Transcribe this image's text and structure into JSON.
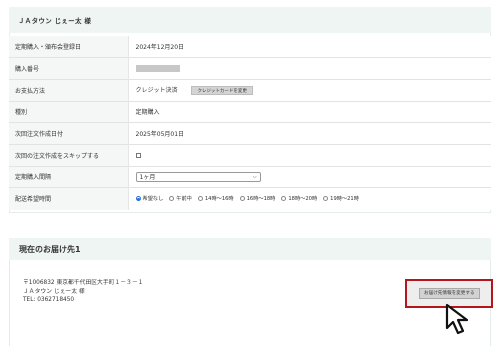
{
  "customer": {
    "name_heading": "ＪＡタウン じぇー太 様"
  },
  "details": {
    "rows": [
      {
        "label": "定期購入・頒布会登録日",
        "value": "2024年12月20日"
      },
      {
        "label": "購入番号",
        "value": ""
      },
      {
        "label": "お支払方法",
        "value": "クレジット決済"
      },
      {
        "label": "種別",
        "value": "定期購入"
      },
      {
        "label": "次回注文作成日付",
        "value": "2025年05月01日"
      },
      {
        "label": "次回の注文作成をスキップする",
        "value": ""
      },
      {
        "label": "定期購入間隔",
        "value": ""
      },
      {
        "label": "配送希望時間",
        "value": ""
      }
    ],
    "change_card_button": "クレジットカードを変更",
    "interval_selected": "1ヶ月",
    "skip_checked": false,
    "delivery_times": [
      {
        "label": "希望なし",
        "selected": true
      },
      {
        "label": "午前中",
        "selected": false
      },
      {
        "label": "14時～16時",
        "selected": false
      },
      {
        "label": "16時～18時",
        "selected": false
      },
      {
        "label": "18時～20時",
        "selected": false
      },
      {
        "label": "19時～21時",
        "selected": false
      }
    ]
  },
  "delivery": {
    "title": "現在のお届け先1",
    "address_line": "〒1006832 東京都千代田区大手町１－３－１",
    "recipient": "ＪＡタウン じぇー太 様",
    "phone": "TEL: 0362718450",
    "change_button": "お届け先情報を変更する"
  },
  "colors": {
    "accent_band": "#eef5f2",
    "highlight_border": "#b3161b",
    "radio_selected": "#2a6fd6"
  },
  "icons": {
    "pointer": "mouse-pointer-icon",
    "select_arrow": "chevron-down-icon"
  }
}
